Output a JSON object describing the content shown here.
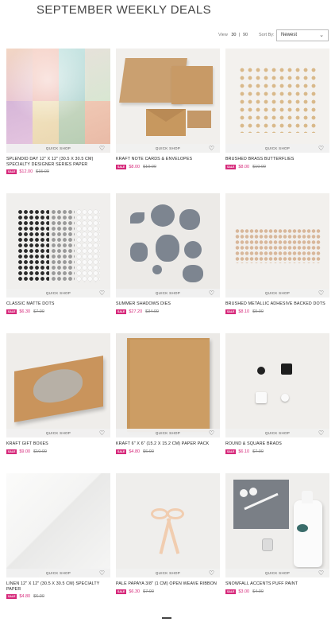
{
  "page": {
    "title": "SEPTEMBER WEEKLY DEALS"
  },
  "toolbar": {
    "view_label": "View",
    "view_count": "30",
    "view_option_alt": "90",
    "sort_label": "Sort By:",
    "sort_value": "Newest"
  },
  "colors": {
    "accent": "#d6287a",
    "badge_text": "#ffffff"
  },
  "card_labels": {
    "quick_shop": "QUICK SHOP",
    "sale_badge": "SALE"
  },
  "products": [
    {
      "name": "SPLENDID DAY 12\" X 12\" (30.5 X 30.5 CM) SPECIALTY DESIGNER SERIES PAPER",
      "sale_price": "$12.00",
      "old_price": "$15.00"
    },
    {
      "name": "KRAFT NOTE CARDS & ENVELOPES",
      "sale_price": "$8.00",
      "old_price": "$10.00"
    },
    {
      "name": "BRUSHED BRASS BUTTERFLIES",
      "sale_price": "$8.00",
      "old_price": "$10.00"
    },
    {
      "name": "CLASSIC MATTE DOTS",
      "sale_price": "$6.30",
      "old_price": "$7.00"
    },
    {
      "name": "SUMMER SHADOWS DIES",
      "sale_price": "$27.20",
      "old_price": "$34.00"
    },
    {
      "name": "BRUSHED METALLIC ADHESIVE BACKED DOTS",
      "sale_price": "$8.10",
      "old_price": "$9.00"
    },
    {
      "name": "KRAFT GIFT BOXES",
      "sale_price": "$9.00",
      "old_price": "$10.00"
    },
    {
      "name": "KRAFT 6\" X 6\" (15.2 X 15.2 CM) PAPER PACK",
      "sale_price": "$4.80",
      "old_price": "$6.00"
    },
    {
      "name": "ROUND & SQUARE BRADS",
      "sale_price": "$6.10",
      "old_price": "$7.00"
    },
    {
      "name": "LINEN 12\" X 12\" (30.5 X 30.5 CM) SPECIALTY PAPER",
      "sale_price": "$4.80",
      "old_price": "$6.00"
    },
    {
      "name": "PALE PAPAYA 3/8\" (1 CM) OPEN WEAVE RIBBON",
      "sale_price": "$6.30",
      "old_price": "$7.00"
    },
    {
      "name": "SNOWFALL ACCENTS PUFF PAINT",
      "sale_price": "$3.00",
      "old_price": "$4.00"
    }
  ]
}
